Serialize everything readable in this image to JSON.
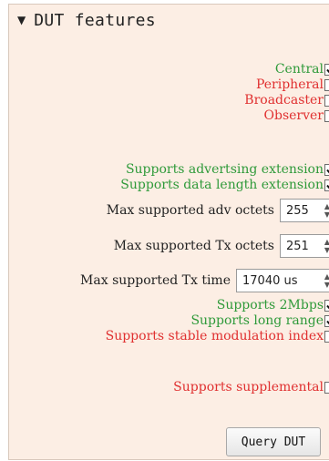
{
  "section": {
    "title": "DUT features",
    "expanded_icon": "triangle-down-icon"
  },
  "roles": [
    {
      "label": "Central",
      "checked": true,
      "color": "#2f9a3a"
    },
    {
      "label": "Peripheral",
      "checked": false,
      "color": "#e03030"
    },
    {
      "label": "Broadcaster",
      "checked": false,
      "color": "#e03030"
    },
    {
      "label": "Observer",
      "checked": false,
      "color": "#e03030"
    }
  ],
  "extensions": {
    "adv_ext": {
      "label": "Supports advertsing extension",
      "checked": true
    },
    "data_len": {
      "label": "Supports data length extension",
      "checked": true
    }
  },
  "spins": {
    "adv_octets": {
      "label": "Max supported adv octets",
      "value": "255"
    },
    "tx_octets": {
      "label": "Max supported Tx octets",
      "value": "251"
    },
    "tx_time": {
      "label": "Max supported Tx time",
      "value": "17040 us"
    }
  },
  "phy": {
    "mbps2": {
      "label": "Supports 2Mbps",
      "checked": true
    },
    "long_range": {
      "label": "Supports long range",
      "checked": true
    },
    "stable_mod": {
      "label": "Supports stable modulation index",
      "checked": false
    }
  },
  "supplemental": {
    "label": "Supports supplemental",
    "checked": false
  },
  "query_button": {
    "label": "Query DUT"
  }
}
